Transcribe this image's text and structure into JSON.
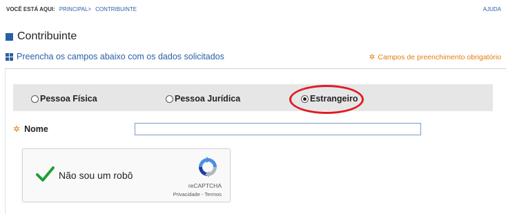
{
  "breadcrumb": {
    "label": "VOCÊ ESTÁ AQUI:",
    "items": [
      "PRINCIPAL>",
      "CONTRIBUINTE"
    ]
  },
  "help_link": "AJUDA",
  "page_title": "Contribuinte",
  "instructions": "Preencha os campos abaixo com os dados solicitados",
  "required_note": "Campos de preenchimento obrigatório",
  "person_type": {
    "options": [
      {
        "label": "Pessoa Física",
        "checked": false
      },
      {
        "label": "Pessoa Jurídica",
        "checked": false
      },
      {
        "label": "Estrangeiro",
        "checked": true
      }
    ]
  },
  "name_field": {
    "label": "Nome",
    "value": ""
  },
  "recaptcha": {
    "label": "Não sou um robô",
    "brand": "reCAPTCHA",
    "links": "Privacidade - Termos"
  },
  "colors": {
    "accent": "#2b5fa5",
    "required": "#e07d10",
    "highlight": "#e01b24",
    "checkmark": "#1e9e3a"
  }
}
